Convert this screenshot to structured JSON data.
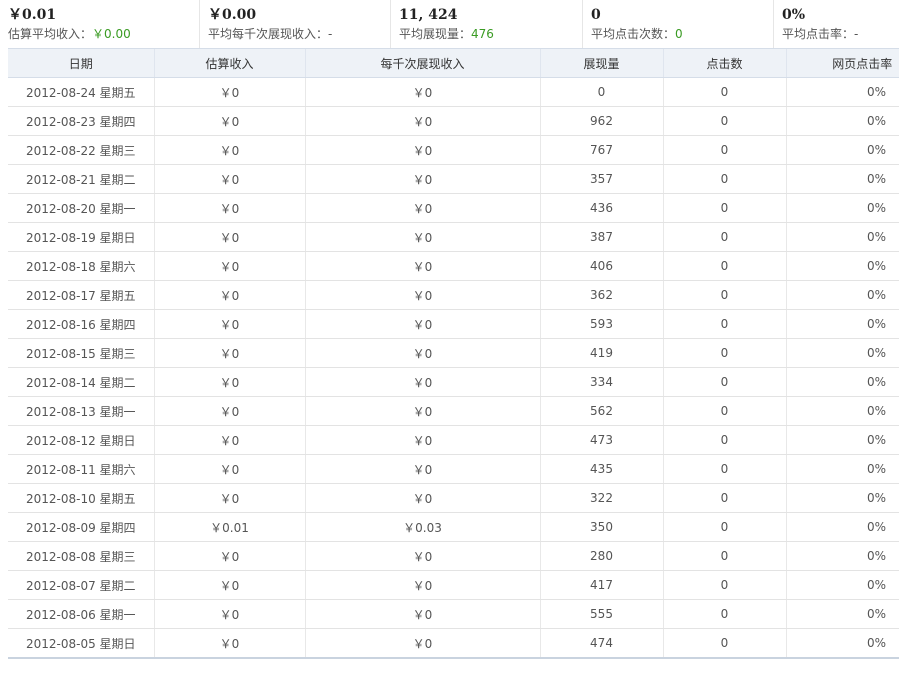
{
  "summary": [
    {
      "value": "￥0.01",
      "label": "估算平均收入：",
      "sub_value": "￥0.00"
    },
    {
      "value": "￥0.00",
      "label": "平均每千次展现收入：",
      "sub_value": "-"
    },
    {
      "value": "11, 424",
      "label": "平均展现量：",
      "sub_value": "476"
    },
    {
      "value": "0",
      "label": "平均点击次数：",
      "sub_value": "0"
    },
    {
      "value": "0%",
      "label": "平均点击率：",
      "sub_value": "-"
    }
  ],
  "table": {
    "headers": [
      "日期",
      "估算收入",
      "每千次展现收入",
      "展现量",
      "点击数",
      "网页点击率"
    ],
    "rows": [
      [
        "2012-08-24 星期五",
        "￥0",
        "￥0",
        "0",
        "0",
        "0%"
      ],
      [
        "2012-08-23 星期四",
        "￥0",
        "￥0",
        "962",
        "0",
        "0%"
      ],
      [
        "2012-08-22 星期三",
        "￥0",
        "￥0",
        "767",
        "0",
        "0%"
      ],
      [
        "2012-08-21 星期二",
        "￥0",
        "￥0",
        "357",
        "0",
        "0%"
      ],
      [
        "2012-08-20 星期一",
        "￥0",
        "￥0",
        "436",
        "0",
        "0%"
      ],
      [
        "2012-08-19 星期日",
        "￥0",
        "￥0",
        "387",
        "0",
        "0%"
      ],
      [
        "2012-08-18 星期六",
        "￥0",
        "￥0",
        "406",
        "0",
        "0%"
      ],
      [
        "2012-08-17 星期五",
        "￥0",
        "￥0",
        "362",
        "0",
        "0%"
      ],
      [
        "2012-08-16 星期四",
        "￥0",
        "￥0",
        "593",
        "0",
        "0%"
      ],
      [
        "2012-08-15 星期三",
        "￥0",
        "￥0",
        "419",
        "0",
        "0%"
      ],
      [
        "2012-08-14 星期二",
        "￥0",
        "￥0",
        "334",
        "0",
        "0%"
      ],
      [
        "2012-08-13 星期一",
        "￥0",
        "￥0",
        "562",
        "0",
        "0%"
      ],
      [
        "2012-08-12 星期日",
        "￥0",
        "￥0",
        "473",
        "0",
        "0%"
      ],
      [
        "2012-08-11 星期六",
        "￥0",
        "￥0",
        "435",
        "0",
        "0%"
      ],
      [
        "2012-08-10 星期五",
        "￥0",
        "￥0",
        "322",
        "0",
        "0%"
      ],
      [
        "2012-08-09 星期四",
        "￥0.01",
        "￥0.03",
        "350",
        "0",
        "0%"
      ],
      [
        "2012-08-08 星期三",
        "￥0",
        "￥0",
        "280",
        "0",
        "0%"
      ],
      [
        "2012-08-07 星期二",
        "￥0",
        "￥0",
        "417",
        "0",
        "0%"
      ],
      [
        "2012-08-06 星期一",
        "￥0",
        "￥0",
        "555",
        "0",
        "0%"
      ],
      [
        "2012-08-05 星期日",
        "￥0",
        "￥0",
        "474",
        "0",
        "0%"
      ]
    ]
  },
  "colors": {
    "positive": "#3a9b23",
    "header_bg": "#eef2f7"
  }
}
